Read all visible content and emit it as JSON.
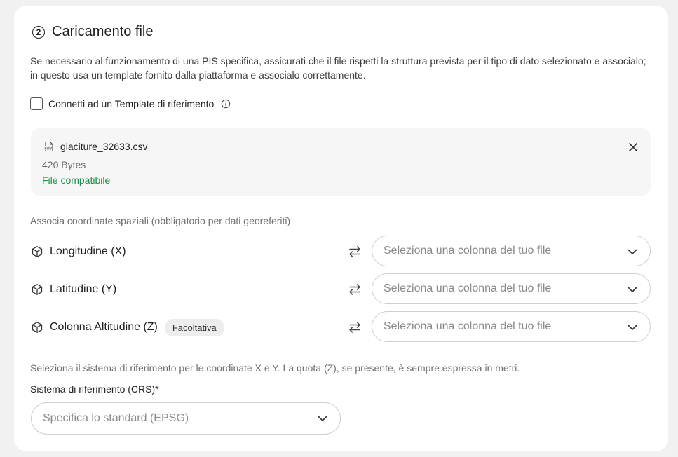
{
  "section": {
    "step_number": "2",
    "title": "Caricamento file",
    "description": "Se necessario al funzionamento di una PIS specifica, assicurati che il file rispetti la struttura prevista per il tipo di dato selezionato e associalo; in questo usa un template fornito dalla piattaforma e associalo correttamente."
  },
  "template_checkbox": {
    "label": "Connetti ad un Template di riferimento",
    "checked": false,
    "info_icon": "info-icon"
  },
  "file": {
    "icon": "csv-file-icon",
    "name": "giaciture_32633.csv",
    "size": "420 Bytes",
    "status": "File compatibile",
    "status_color": "#1e8f4c",
    "remove_icon": "close-icon"
  },
  "coordinates": {
    "section_label": "Associa coordinate spaziali (obbligatorio per dati georeferiti)",
    "rows": [
      {
        "label": "Longitudine (X)",
        "badge": "",
        "select_placeholder": "Seleziona una colonna del tuo file"
      },
      {
        "label": "Latitudine (Y)",
        "badge": "",
        "select_placeholder": "Seleziona una colonna del tuo file"
      },
      {
        "label": "Colonna Altitudine (Z)",
        "badge": "Facoltativa",
        "select_placeholder": "Seleziona una colonna del tuo file"
      }
    ]
  },
  "crs": {
    "description": "Seleziona il sistema di riferimento per le coordinate X e Y. La quota (Z), se presente, è sempre espressa in metri.",
    "label": "Sistema di riferimento (CRS)*",
    "select_placeholder": "Specifica lo standard (EPSG)"
  }
}
